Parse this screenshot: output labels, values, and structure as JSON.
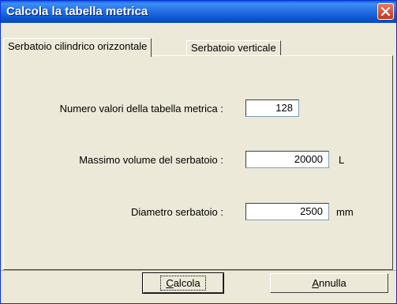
{
  "window": {
    "title": "Calcola la tabella metrica"
  },
  "tabs": [
    {
      "label": "Serbatoio cilindrico orizzontale",
      "active": true
    },
    {
      "label": "Serbatoio verticale",
      "active": false
    }
  ],
  "fields": {
    "num_values": {
      "label": "Numero valori della tabella metrica :",
      "value": "128",
      "unit": ""
    },
    "max_volume": {
      "label": "Massimo volume del serbatoio :",
      "value": "20000",
      "unit": "L"
    },
    "diameter": {
      "label": "Diametro serbatoio :",
      "value": "2500",
      "unit": "mm"
    }
  },
  "buttons": {
    "calculate": "Calcola",
    "cancel": "Annulla"
  },
  "icons": {
    "close": "close-icon"
  },
  "colors": {
    "titlebar": "#0a5fd8",
    "close": "#c2361c"
  }
}
